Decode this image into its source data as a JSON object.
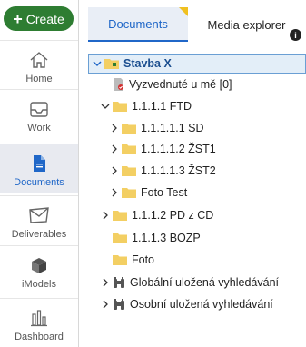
{
  "nav": {
    "create_label": "Create",
    "items": [
      {
        "label": "Home",
        "icon": "home-icon"
      },
      {
        "label": "Work",
        "icon": "inbox-icon"
      },
      {
        "label": "Documents",
        "icon": "document-icon",
        "active": true
      },
      {
        "label": "Deliverables",
        "icon": "envelope-icon"
      },
      {
        "label": "iModels",
        "icon": "cube-icon"
      },
      {
        "label": "Dashboard",
        "icon": "bar-chart-icon"
      }
    ]
  },
  "tabs": [
    {
      "label": "Documents",
      "active": true
    },
    {
      "label": "Media explorer",
      "active": false
    }
  ],
  "tree": [
    {
      "label": "Stavba X",
      "expanded": true,
      "selected": true,
      "icon": "project-folder-icon"
    },
    {
      "label": "Vyzvednuté u mě [0]",
      "icon": "checked-out-icon"
    },
    {
      "label": "1.1.1.1 FTD",
      "expanded": true,
      "icon": "folder-icon"
    },
    {
      "label": "1.1.1.1.1 SD",
      "expanded": false,
      "icon": "folder-icon"
    },
    {
      "label": "1.1.1.1.2 ŽST1",
      "expanded": false,
      "icon": "folder-icon"
    },
    {
      "label": "1.1.1.1.3 ŽST2",
      "expanded": false,
      "icon": "folder-icon"
    },
    {
      "label": "Foto Test",
      "expanded": false,
      "icon": "folder-icon"
    },
    {
      "label": "1.1.1.2 PD z CD",
      "expanded": false,
      "icon": "folder-icon"
    },
    {
      "label": "1.1.1.3 BOZP",
      "icon": "folder-icon"
    },
    {
      "label": "Foto",
      "icon": "folder-icon"
    },
    {
      "label": "Globální uložená vyhledávání",
      "expanded": false,
      "icon": "binoculars-icon"
    },
    {
      "label": "Osobní uložená vyhledávání",
      "expanded": false,
      "icon": "binoculars-icon"
    }
  ],
  "colors": {
    "create_button": "#2e7d32",
    "accent": "#2067c8",
    "folder": "#f3cf63"
  }
}
